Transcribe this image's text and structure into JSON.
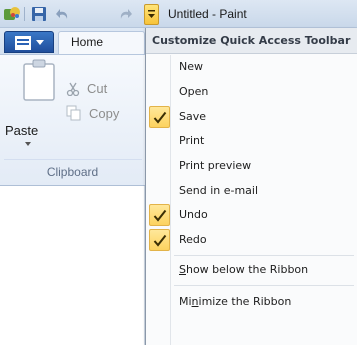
{
  "window": {
    "title": "Untitled - Paint"
  },
  "ribbon": {
    "tab_home": "Home",
    "clipboard": {
      "paste_label": "Paste",
      "cut_label": "Cut",
      "copy_label": "Copy",
      "group_label": "Clipboard"
    }
  },
  "menu": {
    "header": "Customize Quick Access Toolbar",
    "items": [
      {
        "label": "New",
        "checked": false
      },
      {
        "label": "Open",
        "checked": false
      },
      {
        "label": "Save",
        "checked": true
      },
      {
        "label": "Print",
        "checked": false
      },
      {
        "label": "Print preview",
        "checked": false
      },
      {
        "label": "Send in e-mail",
        "checked": false
      },
      {
        "label": "Undo",
        "checked": true
      },
      {
        "label": "Redo",
        "checked": true
      }
    ],
    "show_below": {
      "pre": "",
      "key": "S",
      "post": "how below the Ribbon"
    },
    "minimize": {
      "pre": "Mi",
      "key": "n",
      "post": "imize the Ribbon"
    }
  },
  "colors": {
    "check_highlight": "#fcd25f",
    "title_bar": "#c9d8ea",
    "file_button": "#2a62b5"
  }
}
